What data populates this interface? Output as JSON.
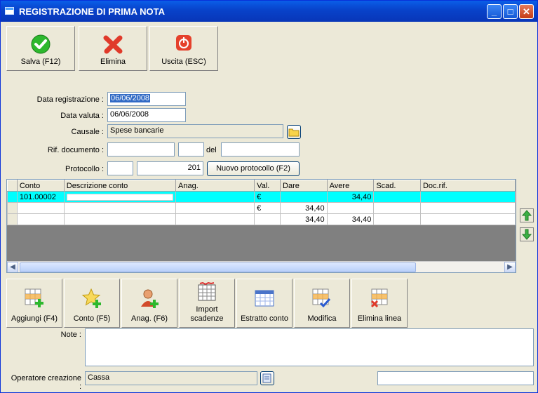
{
  "window": {
    "title": "REGISTRAZIONE DI PRIMA NOTA",
    "minimize": "_",
    "maximize": "□",
    "close": "✕"
  },
  "toolbar": {
    "save_label": "Salva (F12)",
    "delete_label": "Elimina",
    "exit_label": "Uscita (ESC)"
  },
  "form": {
    "data_registrazione_label": "Data registrazione :",
    "data_registrazione_value": "06/06/2008",
    "data_valuta_label": "Data valuta :",
    "data_valuta_value": "06/06/2008",
    "causale_label": "Causale :",
    "causale_value": "Spese bancarie",
    "rif_documento_label": "Rif. documento :",
    "rif_documento_value": "",
    "rif_documento_num": "",
    "del_label": "del",
    "del_value": "",
    "protocollo_label": "Protocollo :",
    "protocollo_prefix": "",
    "protocollo_value": "201",
    "nuovo_protocollo_label": "Nuovo protocollo (F2)"
  },
  "grid": {
    "columns": [
      "Conto",
      "Descrizione conto",
      "Anag.",
      "Val.",
      "Dare",
      "Avere",
      "Scad.",
      "Doc.rif."
    ],
    "rows": [
      {
        "conto": "101.00002",
        "descrizione": "",
        "anag": "",
        "val": "€",
        "dare": "",
        "avere": "34,40",
        "scad": "",
        "docrif": ""
      },
      {
        "conto": "",
        "descrizione": "",
        "anag": "",
        "val": "€",
        "dare": "34,40",
        "avere": "",
        "scad": "",
        "docrif": ""
      },
      {
        "conto": "",
        "descrizione": "",
        "anag": "",
        "val": "",
        "dare": "34,40",
        "avere": "34,40",
        "scad": "",
        "docrif": ""
      }
    ]
  },
  "bottom_toolbar": {
    "aggiungi": "Aggiungi (F4)",
    "conto": "Conto (F5)",
    "anag": "Anag. (F6)",
    "import_line1": "Import",
    "import_line2": "scadenze",
    "estratto": "Estratto conto",
    "modifica": "Modifica",
    "elimina_linea": "Elimina linea"
  },
  "note_label": "Note :",
  "note_value": "",
  "operatore_label": "Operatore creazione :",
  "operatore_value": "Cassa",
  "status_value": "",
  "colors": {
    "title_bar": "#0842c9",
    "selected_row": "#00ffff",
    "selection": "#316ac5"
  }
}
